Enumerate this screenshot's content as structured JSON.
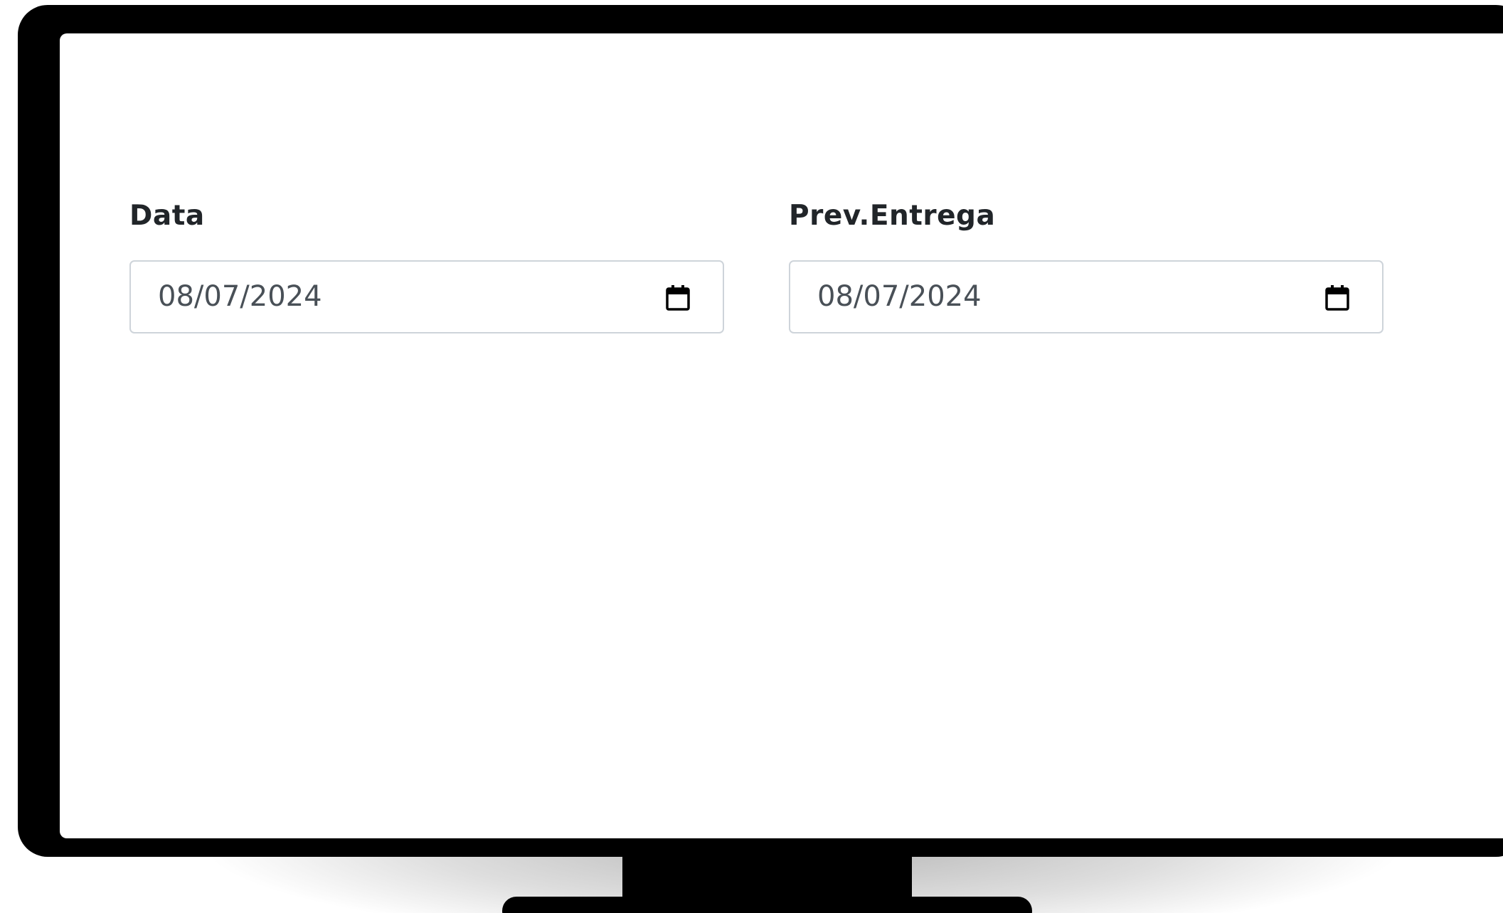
{
  "form": {
    "fields": [
      {
        "label": "Data",
        "value": "08/07/2024",
        "icon": "calendar-icon"
      },
      {
        "label": "Prev.Entrega",
        "value": "08/07/2024",
        "icon": "calendar-icon"
      }
    ]
  },
  "colors": {
    "label_text": "#212529",
    "input_text": "#495057",
    "input_border": "#ced4da",
    "frame": "#000000",
    "screen_bg": "#ffffff"
  }
}
